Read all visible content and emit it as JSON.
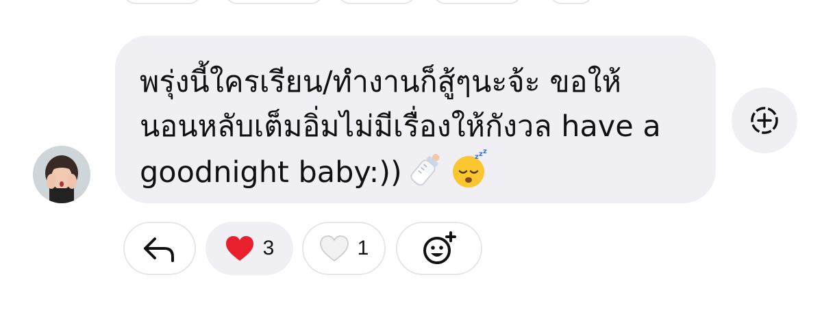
{
  "message": {
    "lines": [
      "พรุ่งนี้ใครเรียน/ทำงานก็สู้ๆนะจ้ะ ขอให้",
      "นอนหลับเต็มอิ่มไม่มีเรื่องให้กังวล have a",
      "goodnight baby:))"
    ],
    "emojis": [
      "baby-bottle",
      "sleeping-face"
    ]
  },
  "reactions": [
    {
      "icon": "reply-icon",
      "count": null,
      "selected": false
    },
    {
      "icon": "red-heart-icon",
      "count": "3",
      "selected": true
    },
    {
      "icon": "white-heart-icon",
      "count": "1",
      "selected": false
    },
    {
      "icon": "add-emoji-icon",
      "count": null,
      "selected": false
    }
  ],
  "colors": {
    "bubble": "#efeff4",
    "heart": "#e8202e",
    "text": "#111111",
    "pill_border": "#e6e6ea"
  }
}
